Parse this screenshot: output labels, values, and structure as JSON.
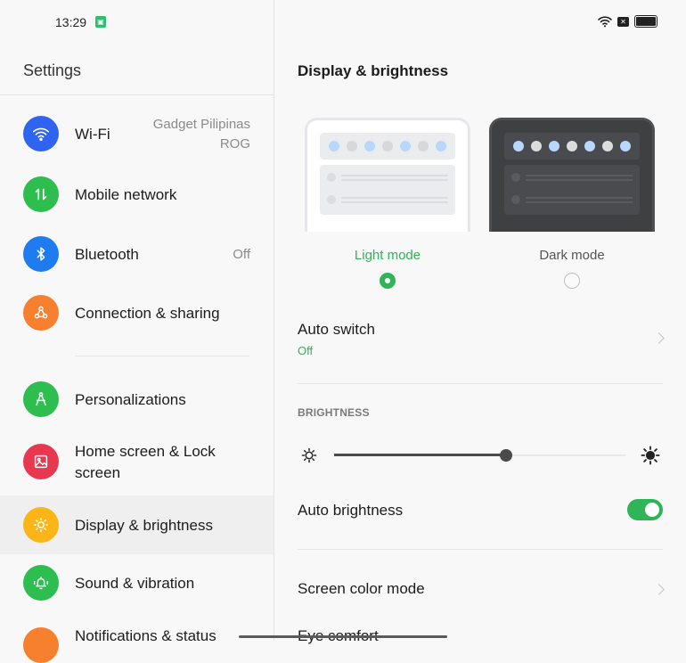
{
  "status_bar": {
    "time": "13:29",
    "notification_badge": "android-icon",
    "icons": [
      "wifi-icon",
      "sim-none-icon",
      "battery-icon"
    ]
  },
  "sidebar": {
    "title": "Settings",
    "items": [
      {
        "label": "Wi-Fi",
        "value": "Gadget Pilipinas ROG",
        "value_line1": "Gadget Pilipinas",
        "value_line2": "ROG",
        "icon": "wifi-icon",
        "color": "#2f64f0"
      },
      {
        "label": "Mobile network",
        "icon": "data-arrows-icon",
        "color": "#2ebd4f"
      },
      {
        "label": "Bluetooth",
        "value": "Off",
        "icon": "bluetooth-icon",
        "color": "#1f7cf0"
      },
      {
        "label": "Connection & sharing",
        "icon": "share-icon",
        "color": "#f6802e"
      },
      {
        "label": "Personalizations",
        "icon": "compass-icon",
        "color": "#2ebd4f"
      },
      {
        "label": "Home screen & Lock screen",
        "label_line1": "Home screen & Lock",
        "label_line2": "screen",
        "icon": "image-icon",
        "color": "#e8384f"
      },
      {
        "label": "Display & brightness",
        "icon": "sun-icon",
        "color": "#fbb517",
        "active": true
      },
      {
        "label": "Sound & vibration",
        "icon": "bell-icon",
        "color": "#2ebd4f"
      },
      {
        "label": "Notifications & status",
        "icon": "notification-icon",
        "color": "#f6802e"
      }
    ]
  },
  "main": {
    "title": "Display & brightness",
    "modes": [
      {
        "label": "Light mode",
        "selected": true
      },
      {
        "label": "Dark mode",
        "selected": false
      }
    ],
    "auto_switch": {
      "label": "Auto switch",
      "value": "Off"
    },
    "brightness_section": "BRIGHTNESS",
    "brightness_level": 0.59,
    "auto_brightness": {
      "label": "Auto brightness",
      "enabled": true
    },
    "screen_color_mode": {
      "label": "Screen color mode"
    },
    "eye_comfort": {
      "label": "Eye comfort"
    }
  },
  "colors": {
    "accent": "#2fb457",
    "preview_blue": "#b7d8fb",
    "preview_gray": "#d8d8d8"
  }
}
